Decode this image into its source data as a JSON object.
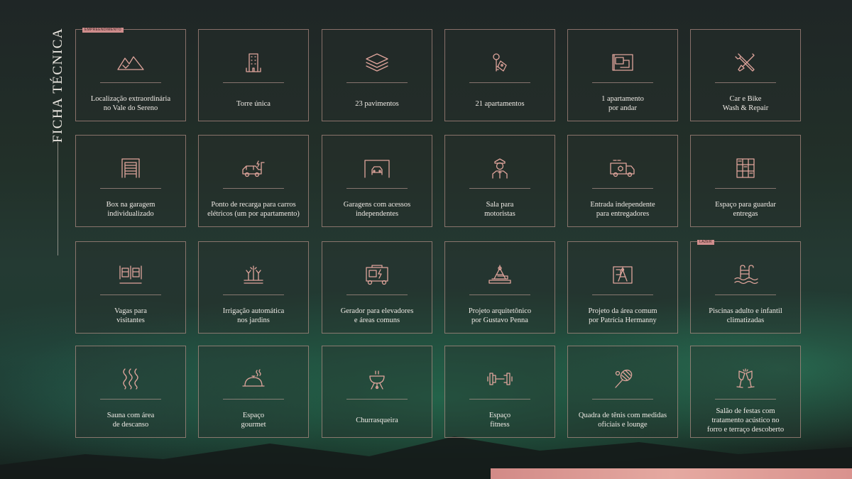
{
  "side_title": "FICHA TÉCNICA",
  "tags": {
    "empreendimento": "EMPREENDIMENTO",
    "lazer": "LAZER"
  },
  "accent_color": "#e0a59c",
  "cards": [
    {
      "icon": "mountain-icon",
      "label": "Localização extraordinária\nno Vale do Sereno"
    },
    {
      "icon": "tower-building-icon",
      "label": "Torre única"
    },
    {
      "icon": "stacked-layers-icon",
      "label": "23 pavimentos"
    },
    {
      "icon": "keys-icon",
      "label": "21 apartamentos"
    },
    {
      "icon": "floor-plan-icon",
      "label": "1 apartamento\npor andar"
    },
    {
      "icon": "tools-icon",
      "label": "Car e Bike\nWash & Repair"
    },
    {
      "icon": "garage-door-icon",
      "label": "Box na garagem\nindividualizado"
    },
    {
      "icon": "electric-car-charging-icon",
      "label": "Ponto de recarga para carros\nelétricos (um por apartamento)"
    },
    {
      "icon": "garage-car-icon",
      "label": "Garagens com acessos\nindependentes"
    },
    {
      "icon": "chauffeur-icon",
      "label": "Sala para\nmotoristas"
    },
    {
      "icon": "delivery-truck-icon",
      "label": "Entrada independente\npara entregadores"
    },
    {
      "icon": "lockers-icon",
      "label": "Espaço para guardar\nentregas"
    },
    {
      "icon": "visitor-cars-icon",
      "label": "Vagas para\nvisitantes"
    },
    {
      "icon": "irrigation-icon",
      "label": "Irrigação automática\nnos jardins"
    },
    {
      "icon": "generator-icon",
      "label": "Gerador para elevadores\ne áreas comuns"
    },
    {
      "icon": "architect-compass-icon",
      "label": "Projeto arquitetônico\npor Gustavo Penna"
    },
    {
      "icon": "blueprint-compass-icon",
      "label": "Projeto da área comum\npor Patrícia Hermanny"
    },
    {
      "icon": "pool-icon",
      "label": "Piscinas adulto e infantil\nclimatizadas"
    },
    {
      "icon": "sauna-steam-icon",
      "label": "Sauna com área\nde descanso"
    },
    {
      "icon": "cloche-icon",
      "label": "Espaço\ngourmet"
    },
    {
      "icon": "barbecue-grill-icon",
      "label": "Churrasqueira"
    },
    {
      "icon": "dumbbell-icon",
      "label": "Espaço\nfitness"
    },
    {
      "icon": "tennis-racket-icon",
      "label": "Quadra de tênis com medidas\noficiais e lounge"
    },
    {
      "icon": "champagne-glasses-icon",
      "label": "Salão de festas com\ntratamento acústico no\nforro e terraço descoberto"
    }
  ]
}
